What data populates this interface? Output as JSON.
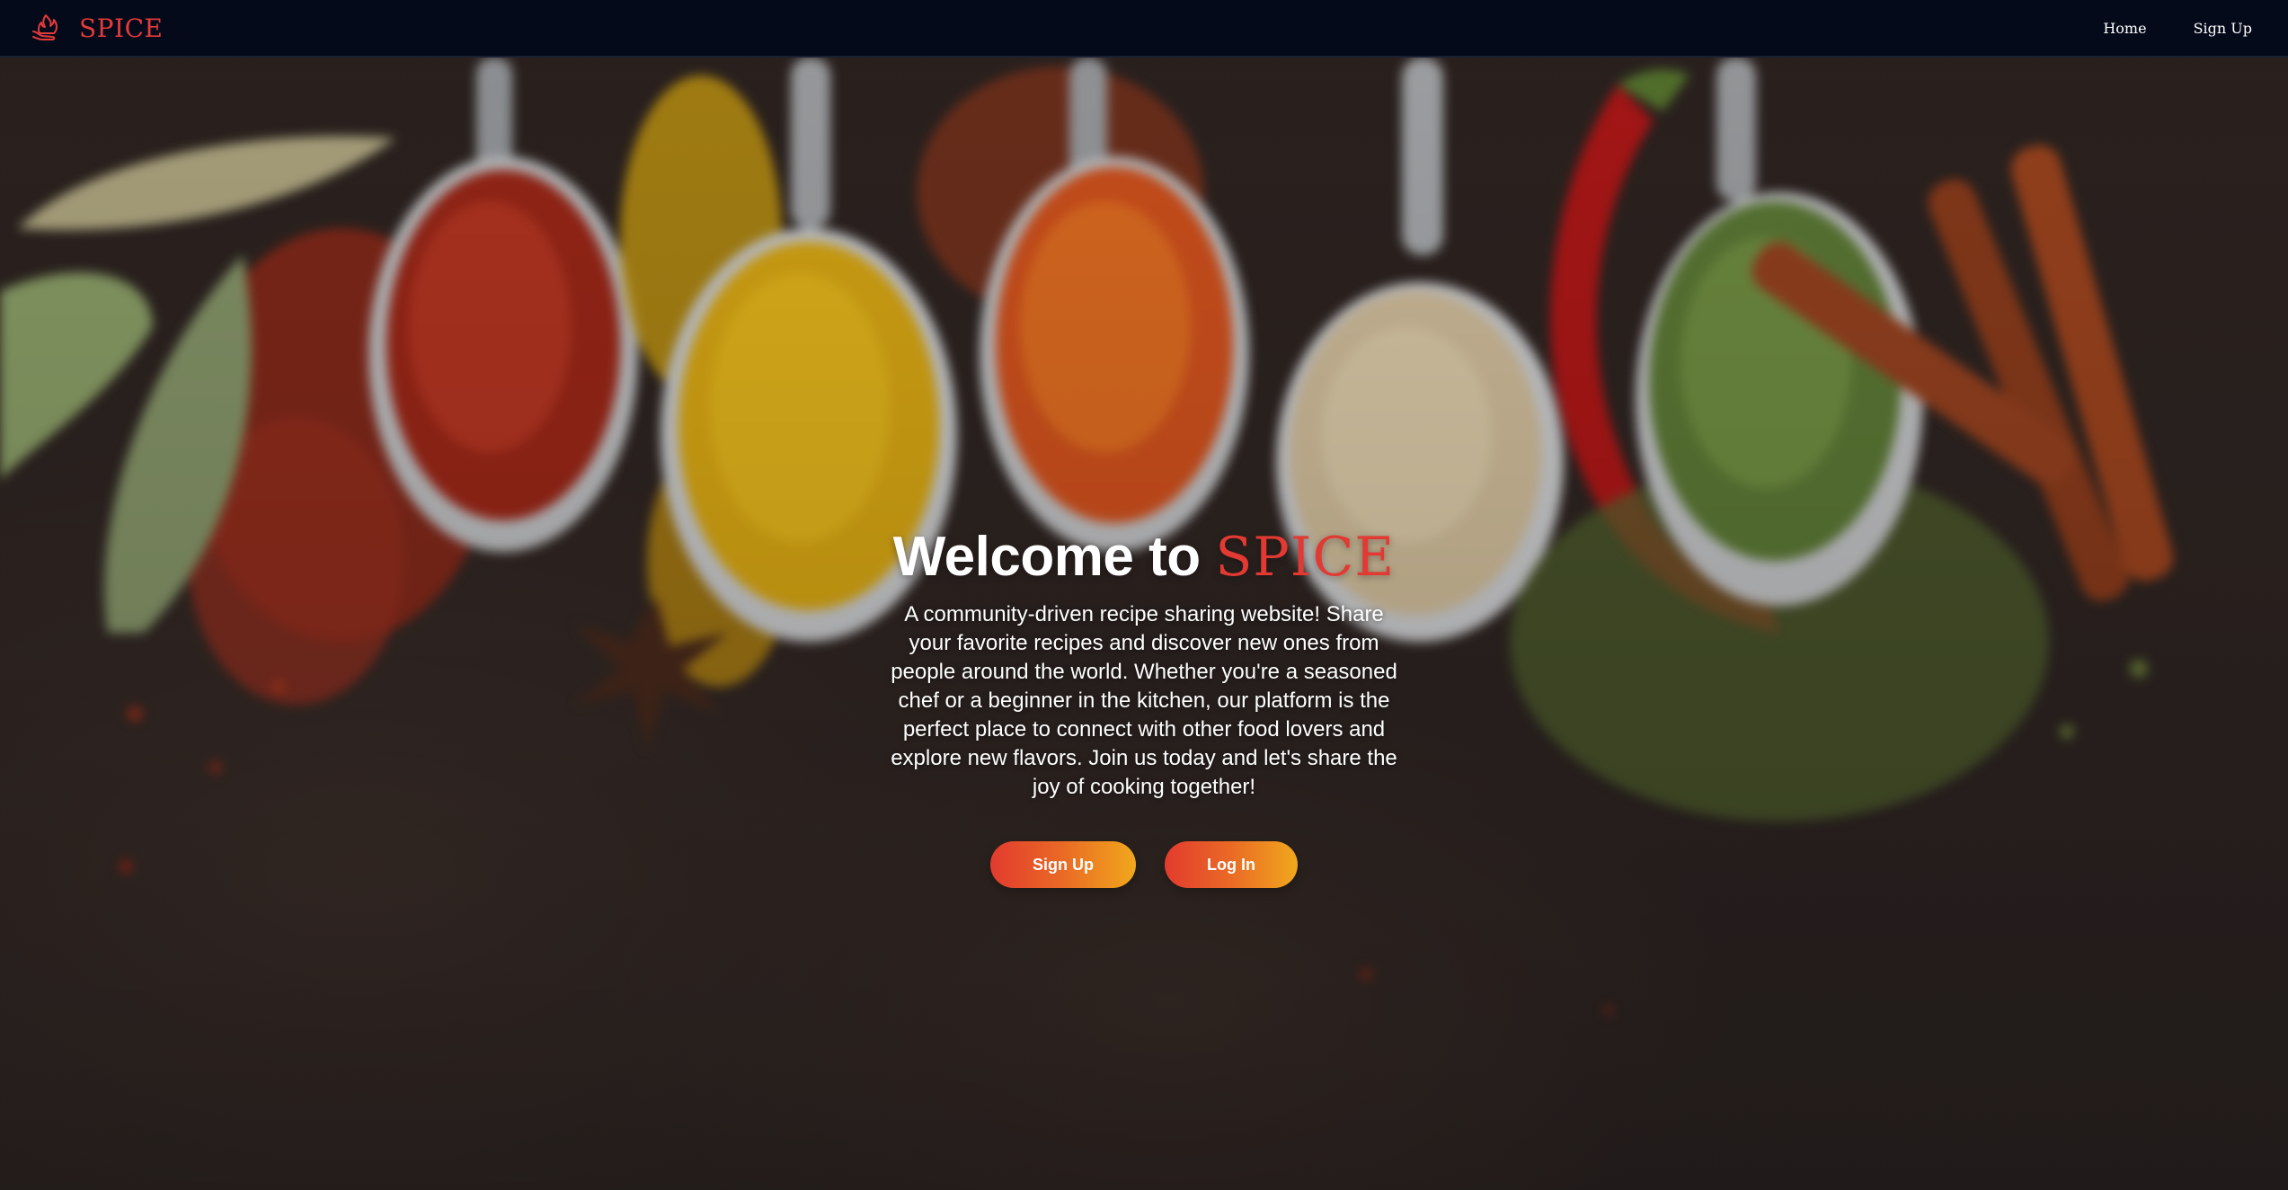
{
  "navbar": {
    "brand": "SPICE",
    "brand_icon": "flame-hand-icon",
    "links": [
      "Home",
      "Sign Up"
    ]
  },
  "hero": {
    "title_prefix": "Welcome to",
    "title_brand": "SPICE",
    "description": "A community-driven recipe sharing website! Share your favorite recipes and discover new ones from people around the world. Whether you're a seasoned chef or a beginner in the kitchen, our platform is the perfect place to connect with other food lovers and explore new flavors. Join us today and let's share the joy of cooking together!",
    "buttons": {
      "signup": "Sign Up",
      "login": "Log In"
    }
  },
  "colors": {
    "navbar_bg": "#050a1a",
    "brand_red": "#e33a3a",
    "button_gradient_start": "#e23b2e",
    "button_gradient_end": "#f0a81c"
  }
}
